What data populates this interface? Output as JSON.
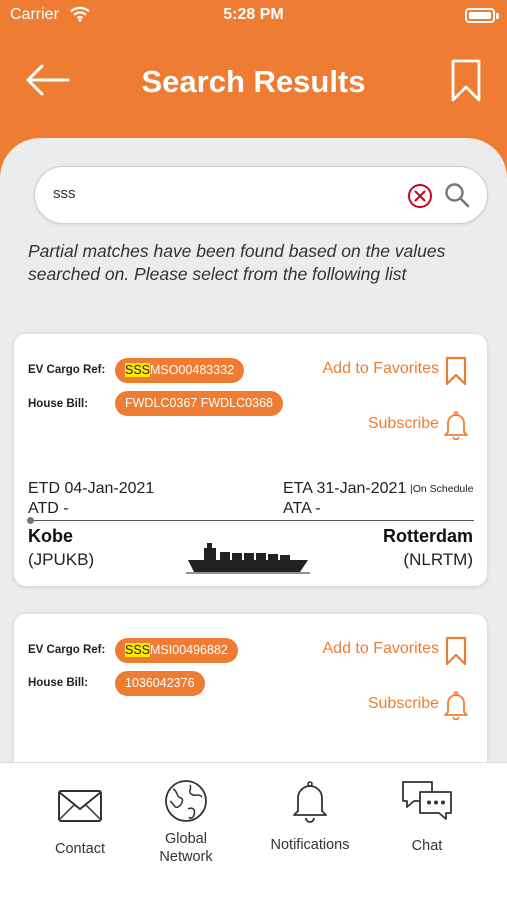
{
  "status_bar": {
    "carrier": "Carrier",
    "time": "5:28 PM"
  },
  "header": {
    "title": "Search Results"
  },
  "search": {
    "value": "sss",
    "placeholder": ""
  },
  "notice": "Partial matches have been found based on the values searched on. Please select from the following list",
  "labels": {
    "ev_cargo_ref": "EV Cargo Ref:",
    "house_bill": "House Bill:",
    "add_to_favorites": "Add to Favorites",
    "subscribe": "Subscribe"
  },
  "results": [
    {
      "ref_highlight": "SSS",
      "ref_rest": "MSO00483332",
      "house_bill": "FWDLC0367 FWDLC0368",
      "etd": "ETD 04-Jan-2021",
      "atd": "ATD -",
      "eta": "ETA 31-Jan-2021",
      "ata": "ATA -",
      "status": "|On Schedule",
      "origin_city": "Kobe",
      "origin_code": "(JPUKB)",
      "dest_city": "Rotterdam",
      "dest_code": "(NLRTM)"
    },
    {
      "ref_highlight": "SSS",
      "ref_rest": "MSI00496882",
      "house_bill": "1036042376"
    }
  ],
  "bottom_nav": [
    {
      "label": "Contact",
      "icon": "envelope-icon"
    },
    {
      "label": "Global Network",
      "label_line1": "Global",
      "label_line2": "Network",
      "icon": "globe-icon"
    },
    {
      "label": "Notifications",
      "icon": "bell-icon"
    },
    {
      "label": "Chat",
      "icon": "chat-bubbles-icon"
    }
  ],
  "colors": {
    "accent": "#ee7d33",
    "highlight": "#ffea00",
    "background": "#ececec"
  }
}
